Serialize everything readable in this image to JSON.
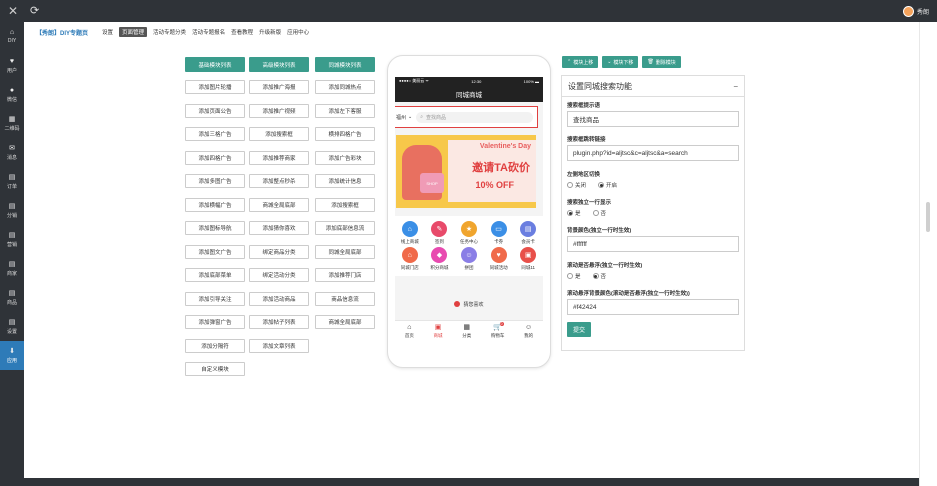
{
  "topbar": {
    "user_name": "秀朗"
  },
  "sidebar": {
    "items": [
      {
        "label": "DIY",
        "icon": "⌂"
      },
      {
        "label": "用户",
        "icon": "♥"
      },
      {
        "label": "微信",
        "icon": "●"
      },
      {
        "label": "二维码",
        "icon": "▦"
      },
      {
        "label": "消息",
        "icon": "✉"
      },
      {
        "label": "订单",
        "icon": "▤"
      },
      {
        "label": "分销",
        "icon": "▤"
      },
      {
        "label": "营销",
        "icon": "▤"
      },
      {
        "label": "商家",
        "icon": "▤"
      },
      {
        "label": "商品",
        "icon": "▤"
      },
      {
        "label": "设置",
        "icon": "▤"
      },
      {
        "label": "应用",
        "icon": "⬇"
      }
    ]
  },
  "nav": {
    "title": "【秀朗】DIY专题页",
    "links": [
      "设置",
      "页面管理",
      "活动专题分类",
      "活动专题报名",
      "查看教程",
      "升级新版",
      "应用中心"
    ]
  },
  "modules": {
    "headers": [
      "基础模块列表",
      "高级模块列表",
      "同城模块列表"
    ],
    "col1": [
      "添加图片轮播",
      "添加页面公告",
      "添加三格广告",
      "添加四格广告",
      "添加多图广告",
      "添加横幅广告",
      "添加图标导航",
      "添加图文广告",
      "添加底部菜单",
      "添加引导关注",
      "添加弹窗广告",
      "添加分隔符",
      "自定义模块"
    ],
    "col2": [
      "添加推广海报",
      "添加推广视频",
      "添加搜索框",
      "添加推荐商家",
      "添加整点秒杀",
      "商城全局底部",
      "添加猜你喜欢",
      "绑定商品分类",
      "绑定活动分类",
      "添加活动商品",
      "添加帖子列表",
      "添加文章列表"
    ],
    "col3": [
      "添加同城热点",
      "添加左下客服",
      "横排四格广告",
      "添加广告彩块",
      "添加统计信息",
      "添加搜索框",
      "添加底部信息流",
      "同城全局底部",
      "添加推荐门店",
      "商品信息流",
      "商城全局底部"
    ]
  },
  "phone": {
    "carrier": "●●●●○ 美丽云 ᯤ",
    "time": "12:30",
    "battery": "100% ▬",
    "app_title": "同城商城",
    "city": "福州",
    "search_placeholder": "查找商品",
    "banner": {
      "headline": "Valentine's Day",
      "big_text": "邀请TA砍价",
      "discount": "10% OFF",
      "shop_label": "SHOP"
    },
    "icons_row1": [
      {
        "label": "线上商城",
        "color": "#3b8fe6",
        "icon": "⌂"
      },
      {
        "label": "签到",
        "color": "#e84a6a",
        "icon": "✎"
      },
      {
        "label": "任务中心",
        "color": "#f0a52e",
        "icon": "★"
      },
      {
        "label": "卡券",
        "color": "#3b8fe6",
        "icon": "▭"
      },
      {
        "label": "会员卡",
        "color": "#6a7ee0",
        "icon": "▤"
      }
    ],
    "icons_row2": [
      {
        "label": "同城门店",
        "color": "#f06a4a",
        "icon": "⌂"
      },
      {
        "label": "积分商城",
        "color": "#e84ab0",
        "icon": "◆"
      },
      {
        "label": "拼团",
        "color": "#8a7ee6",
        "icon": "☺"
      },
      {
        "label": "同城活动",
        "color": "#f06a4a",
        "icon": "♥"
      },
      {
        "label": "同城11",
        "color": "#e8504a",
        "icon": "▣"
      }
    ],
    "guess_label": "猜您喜欢",
    "tabs": [
      {
        "label": "首页",
        "icon": "⌂"
      },
      {
        "label": "商城",
        "icon": "▣"
      },
      {
        "label": "分类",
        "icon": "▦"
      },
      {
        "label": "购物车",
        "icon": "🛒",
        "badge": "0"
      },
      {
        "label": "我的",
        "icon": "☺"
      }
    ]
  },
  "actions": [
    "模块上移",
    "模块下移",
    "删除模块"
  ],
  "panel": {
    "title": "设置同城搜索功能",
    "collapse": "−",
    "fields": {
      "placeholder_label": "搜索框提示语",
      "placeholder_value": "查找商品",
      "link_label": "搜索框跳转链接",
      "link_value": "plugin.php?id=aljtsc&c=aljtsc&a=search",
      "city_label": "左侧地区切换",
      "city_options": [
        "关闭",
        "开启"
      ],
      "city_selected": "开启",
      "alone_label": "搜索独立一行显示",
      "alone_options": [
        "是",
        "否"
      ],
      "alone_selected": "是",
      "bg_label": "背景颜色(独立一行时生效)",
      "bg_value": "#ffffff",
      "sticky_label": "滚动是否悬浮(独立一行时生效)",
      "sticky_options": [
        "是",
        "否"
      ],
      "sticky_selected": "否",
      "sticky_bg_label": "滚动悬浮背景颜色(滚动是否悬浮(独立一行时生效))",
      "sticky_bg_value": "#f42424",
      "submit": "提交"
    }
  },
  "colors": {
    "accent": "#3a9c8c",
    "dark": "#2f3338",
    "active_side": "#2e7bb8",
    "red": "#e04040"
  }
}
